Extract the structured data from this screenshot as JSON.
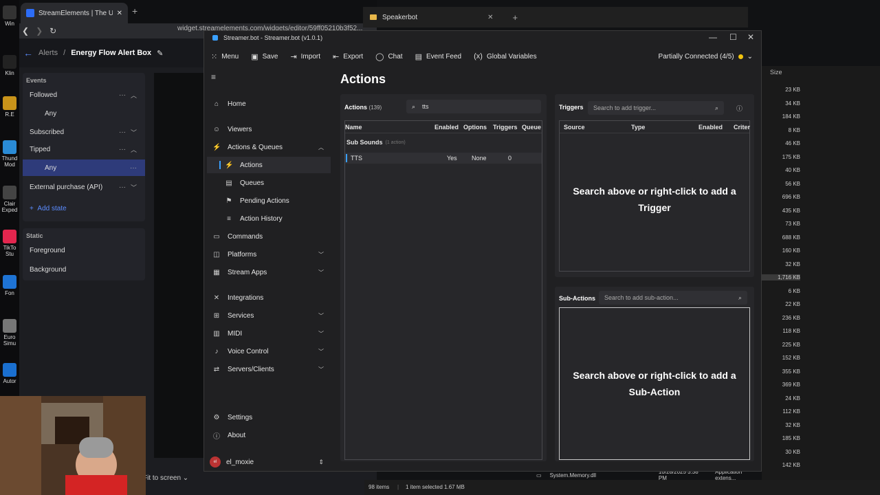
{
  "desktop": {
    "icons": [
      "Win",
      "Klin",
      "R.E",
      "Thund Mod",
      "Clair Exped",
      "TikTo Stu",
      "Fon",
      "Euro Simu",
      "Autor"
    ]
  },
  "browser": {
    "tab_title": "StreamElements | The Ultimate S",
    "new_tab": "+",
    "url": "widget.streamelements.com/widgets/editor/59ff05210b3f52...",
    "breadcrumb_root": "Alerts",
    "breadcrumb_sep": "/",
    "page_title": "Energy Flow Alert Box",
    "events_header": "Events",
    "events": [
      {
        "label": "Followed",
        "state": "open"
      },
      {
        "label": "Any",
        "child": true
      },
      {
        "label": "Subscribed",
        "state": "closed"
      },
      {
        "label": "Tipped",
        "state": "open"
      },
      {
        "label": "Any",
        "child": true,
        "selected": true
      },
      {
        "label": "External purchase (API)",
        "state": "closed"
      }
    ],
    "add_state": "Add state",
    "static_header": "Static",
    "static_items": [
      "Foreground",
      "Background"
    ],
    "fit_label": "Fit to screen"
  },
  "speakerbot_tab": {
    "title": "Speakerbot"
  },
  "explorer": {
    "size_header": "Size",
    "sizes": [
      "23 KB",
      "34 KB",
      "184 KB",
      "8 KB",
      "46 KB",
      "175 KB",
      "40 KB",
      "56 KB",
      "696 KB",
      "435 KB",
      "73 KB",
      "688 KB",
      "160 KB",
      "32 KB",
      "1,716 KB",
      "6 KB",
      "22 KB",
      "236 KB",
      "118 KB",
      "225 KB",
      "152 KB",
      "355 KB",
      "369 KB",
      "24 KB",
      "112 KB",
      "32 KB",
      "185 KB",
      "30 KB",
      "142 KB"
    ],
    "selected_index": 14,
    "file_name": "System.Memory.dll",
    "file_date": "10/28/2025 3:38 PM",
    "file_type": "Application extens...",
    "status_items": "98 items",
    "status_selected": "1 item selected  1.67 MB"
  },
  "streamerbot": {
    "title": "Streamer.bot - Streamer.bot (v1.0.1)",
    "toolbar": [
      {
        "label": "Menu",
        "icon": "grid-icon"
      },
      {
        "label": "Save",
        "icon": "save-icon"
      },
      {
        "label": "Import",
        "icon": "import-icon"
      },
      {
        "label": "Export",
        "icon": "export-icon"
      },
      {
        "label": "Chat",
        "icon": "chat-icon"
      },
      {
        "label": "Event Feed",
        "icon": "feed-icon"
      },
      {
        "label": "Global Variables",
        "icon": "variables-icon"
      }
    ],
    "connection": "Partially Connected (4/5)",
    "connection_color": "#f2c40f",
    "nav": [
      {
        "label": "Home",
        "icon": "home-icon"
      },
      {
        "label": "Viewers",
        "icon": "viewers-icon"
      },
      {
        "label": "Actions & Queues",
        "icon": "actions-icon",
        "expanded": true
      },
      {
        "label": "Actions",
        "sub": true,
        "selected": true
      },
      {
        "label": "Queues",
        "sub": true
      },
      {
        "label": "Pending Actions",
        "sub": true
      },
      {
        "label": "Action History",
        "sub": true
      },
      {
        "label": "Commands",
        "icon": "commands-icon"
      },
      {
        "label": "Platforms",
        "icon": "platforms-icon",
        "chevron": true
      },
      {
        "label": "Stream Apps",
        "icon": "stream-apps-icon",
        "chevron": true
      },
      {
        "label": "Integrations",
        "icon": "integrations-icon"
      },
      {
        "label": "Services",
        "icon": "services-icon",
        "chevron": true
      },
      {
        "label": "MIDI",
        "icon": "midi-icon",
        "chevron": true
      },
      {
        "label": "Voice Control",
        "icon": "voice-icon",
        "chevron": true
      },
      {
        "label": "Servers/Clients",
        "icon": "servers-icon",
        "chevron": true
      },
      {
        "label": "Settings",
        "icon": "settings-icon"
      },
      {
        "label": "About",
        "icon": "about-icon"
      }
    ],
    "user": "el_moxie",
    "heading": "Actions",
    "actions": {
      "label": "Actions",
      "count": "(139)",
      "search_value": "tts",
      "columns": [
        "Name",
        "Enabled",
        "Options",
        "Triggers",
        "Queue"
      ],
      "group": "Sub Sounds",
      "group_count": "(1 action)",
      "rows": [
        {
          "name": "TTS",
          "enabled": "Yes",
          "options": "None",
          "triggers": "0"
        }
      ]
    },
    "triggers": {
      "label": "Triggers",
      "search_placeholder": "Search to add trigger...",
      "columns": [
        "Source",
        "Type",
        "Enabled",
        "Criter"
      ],
      "empty_line1": "Search above or right-click to add a",
      "empty_line2": "Trigger"
    },
    "subactions": {
      "label": "Sub-Actions",
      "search_placeholder": "Search to add sub-action...",
      "empty_line1": "Search above or right-click to add a",
      "empty_line2": "Sub-Action"
    }
  }
}
